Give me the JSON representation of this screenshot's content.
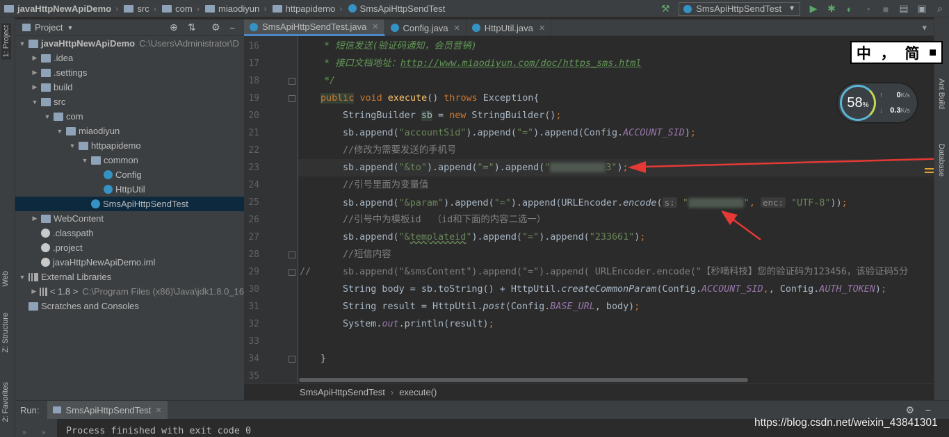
{
  "navbar": {
    "breadcrumbs": [
      "javaHttpNewApiDemo",
      "src",
      "com",
      "miaodiyun",
      "httpapidemo",
      "SmsApiHttpSendTest"
    ],
    "run_config": "SmsApiHttpSendTest"
  },
  "side_tabs": {
    "left": [
      "1: Project",
      "Web",
      "Z: Structure",
      "2: Favorites"
    ],
    "right": [
      "Ant Build",
      "Database"
    ]
  },
  "project": {
    "title": "Project",
    "tree": [
      {
        "label": "javaHttpNewApiDemo",
        "path": "C:\\Users\\Administrator\\D",
        "depth": 0,
        "arrow": "down",
        "icon": "folder",
        "bold": true
      },
      {
        "label": ".idea",
        "depth": 1,
        "arrow": "right",
        "icon": "folder"
      },
      {
        "label": ".settings",
        "depth": 1,
        "arrow": "right",
        "icon": "folder"
      },
      {
        "label": "build",
        "depth": 1,
        "arrow": "right",
        "icon": "folder"
      },
      {
        "label": "src",
        "depth": 1,
        "arrow": "down",
        "icon": "folder"
      },
      {
        "label": "com",
        "depth": 2,
        "arrow": "down",
        "icon": "folder"
      },
      {
        "label": "miaodiyun",
        "depth": 3,
        "arrow": "down",
        "icon": "folder"
      },
      {
        "label": "httpapidemo",
        "depth": 4,
        "arrow": "down",
        "icon": "folder"
      },
      {
        "label": "common",
        "depth": 5,
        "arrow": "down",
        "icon": "folder"
      },
      {
        "label": "Config",
        "depth": 6,
        "arrow": "none",
        "icon": "class"
      },
      {
        "label": "HttpUtil",
        "depth": 6,
        "arrow": "none",
        "icon": "class"
      },
      {
        "label": "SmsApiHttpSendTest",
        "depth": 5,
        "arrow": "none",
        "icon": "class",
        "selected": true
      },
      {
        "label": "WebContent",
        "depth": 1,
        "arrow": "right",
        "icon": "folder"
      },
      {
        "label": ".classpath",
        "depth": 1,
        "arrow": "none",
        "icon": "file"
      },
      {
        "label": ".project",
        "depth": 1,
        "arrow": "none",
        "icon": "file"
      },
      {
        "label": "javaHttpNewApiDemo.iml",
        "depth": 1,
        "arrow": "none",
        "icon": "file"
      },
      {
        "label": "External Libraries",
        "depth": 0,
        "arrow": "down",
        "icon": "lib"
      },
      {
        "label": "< 1.8 >",
        "path": "C:\\Program Files (x86)\\Java\\jdk1.8.0_16",
        "depth": 1,
        "arrow": "right",
        "icon": "lib"
      },
      {
        "label": "Scratches and Consoles",
        "depth": 0,
        "arrow": "none",
        "icon": "folder"
      }
    ]
  },
  "tabs": [
    {
      "label": "SmsApiHttpSendTest.java",
      "active": true
    },
    {
      "label": "Config.java",
      "active": false
    },
    {
      "label": "HttpUtil.java",
      "active": false
    }
  ],
  "line_numbers": [
    "16",
    "17",
    "18",
    "19",
    "20",
    "21",
    "22",
    "23",
    "24",
    "25",
    "26",
    "27",
    "28",
    "29",
    "30",
    "31",
    "32",
    "33",
    "34",
    "35"
  ],
  "code": {
    "l16": "* 短信发送(验证码通知，会员营销)",
    "l17_a": "* 接口文档地址：",
    "l17_b": "http://www.miaodiyun.com/doc/https_sms.html",
    "l18": "*/",
    "l19_a": "public",
    "l19_b": "void",
    "l19_c": "execute",
    "l19_d": "() ",
    "l19_e": "throws",
    "l19_f": " Exception{",
    "l20_a": "StringBuilder ",
    "l20_b": "sb",
    "l20_c": " = ",
    "l20_d": "new",
    "l20_e": " StringBuilder()",
    "l20_f": ";",
    "l21_a": "sb.append(",
    "l21_b": "\"accountSid\"",
    "l21_c": ").append(",
    "l21_d": "\"=\"",
    "l21_e": ").append(Config.",
    "l21_f": "ACCOUNT_SID",
    "l21_g": ")",
    "l22": "//修改为需要发送的手机号",
    "l23_a": "sb.append(",
    "l23_b": "\"&to\"",
    "l23_c": ").append(",
    "l23_d": "\"=\"",
    "l23_e": ").append(",
    "l23_f": "\"",
    "l23_g": "3\"",
    "l23_h": ")",
    "l24": "//引号里面为变量值",
    "l25_a": "sb.append(",
    "l25_b": "\"&param\"",
    "l25_c": ").append(",
    "l25_d": "\"=\"",
    "l25_e": ").append(URLEncoder.",
    "l25_f": "encode",
    "l25_g": "(",
    "l25_h1": "s:",
    "l25_i": "\"",
    "l25_j": "\"",
    "l25_k": ", ",
    "l25_h2": "enc:",
    "l25_l": "\"UTF-8\"",
    "l25_m": "))",
    "l26": "//引号中为模板id  （id和下面的内容二选一）",
    "l27_a": "sb.append(",
    "l27_b": "\"&",
    "l27_c": "templateid",
    "l27_d": "\"",
    "l27_e": ").append(",
    "l27_f": "\"=\"",
    "l27_g": ").append(",
    "l27_h": "\"233661\"",
    "l27_i": ")",
    "l28": "//短信内容",
    "l29_a": "//",
    "l29_b": "sb.append(\"&smsContent\").append(\"=\").append( URLEncoder.encode(\"【秒嘀科技】您的验证码为123456，该验证码5分",
    "l30_a": "String body = sb.toString() + HttpUtil.",
    "l30_b": "createCommonParam",
    "l30_c": "(Config.",
    "l30_d": "ACCOUNT_SID",
    "l30_e": ", Config.",
    "l30_f": "AUTH_TOKEN",
    "l30_g": ")",
    "l31_a": "String result = HttpUtil.",
    "l31_b": "post",
    "l31_c": "(Config.",
    "l31_d": "BASE_URL",
    "l31_e": ", body)",
    "l32_a": "System.",
    "l32_b": "out",
    "l32_c": ".println(result)",
    "l34": "}",
    "semi": ";",
    "comma": ","
  },
  "breadcrumb_bar": {
    "class": "SmsApiHttpSendTest",
    "method": "execute()"
  },
  "run": {
    "label": "Run:",
    "tab": "SmsApiHttpSendTest",
    "output": "Process finished with exit code 0"
  },
  "overlay": {
    "ime_left": "中",
    "ime_mid": "，",
    "ime_right": "简",
    "speed_percent": "58",
    "speed_percent_unit": "%",
    "upload": "0",
    "download": "0.3",
    "unit": "K/s",
    "watermark": "https://blog.csdn.net/weixin_43841301"
  },
  "colors": {
    "accent": "#4a88c7",
    "arrow": "#e53935"
  }
}
